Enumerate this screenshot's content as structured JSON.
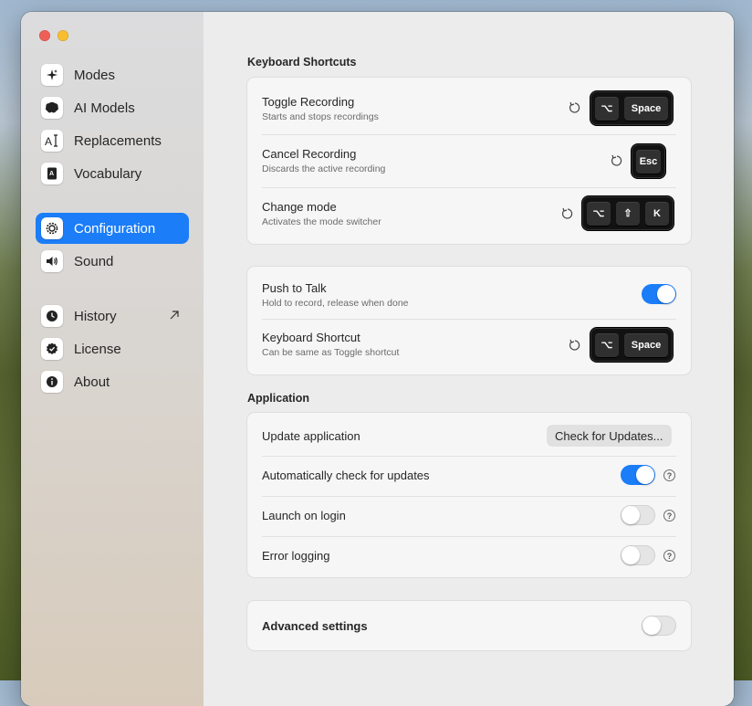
{
  "sidebar": {
    "items": [
      {
        "label": "Modes",
        "icon": "sparkles-icon"
      },
      {
        "label": "AI Models",
        "icon": "brain-icon"
      },
      {
        "label": "Replacements",
        "icon": "text-cursor-icon"
      },
      {
        "label": "Vocabulary",
        "icon": "book-icon"
      },
      {
        "label": "Configuration",
        "icon": "gear-icon",
        "active": true
      },
      {
        "label": "Sound",
        "icon": "speaker-icon"
      },
      {
        "label": "History",
        "icon": "clock-icon",
        "external": true
      },
      {
        "label": "License",
        "icon": "badge-check-icon"
      },
      {
        "label": "About",
        "icon": "info-icon"
      }
    ]
  },
  "keyboard_shortcuts": {
    "title": "Keyboard Shortcuts",
    "toggle_recording": {
      "title": "Toggle Recording",
      "subtitle": "Starts and stops recordings",
      "keys": [
        "⌥",
        "Space"
      ]
    },
    "cancel_recording": {
      "title": "Cancel Recording",
      "subtitle": "Discards the active recording",
      "keys": [
        "Esc"
      ]
    },
    "change_mode": {
      "title": "Change mode",
      "subtitle": "Activates the mode switcher",
      "keys": [
        "⌥",
        "⇧",
        "K"
      ]
    }
  },
  "push_to_talk": {
    "title": "Push to Talk",
    "subtitle": "Hold to record, release when done",
    "enabled": true,
    "shortcut": {
      "title": "Keyboard Shortcut",
      "subtitle": "Can be same as Toggle shortcut",
      "keys": [
        "⌥",
        "Space"
      ]
    }
  },
  "application": {
    "title": "Application",
    "update": {
      "title": "Update application",
      "button": "Check for Updates..."
    },
    "auto_check": {
      "title": "Automatically check for updates",
      "enabled": true
    },
    "launch_on_login": {
      "title": "Launch on login",
      "enabled": false
    },
    "error_logging": {
      "title": "Error logging",
      "enabled": false
    },
    "help_glyph": "?"
  },
  "advanced": {
    "title": "Advanced settings",
    "enabled": false
  },
  "colors": {
    "accent": "#1b7df8",
    "traffic_red": "#ee5f58",
    "traffic_yellow": "#f7be2f"
  }
}
